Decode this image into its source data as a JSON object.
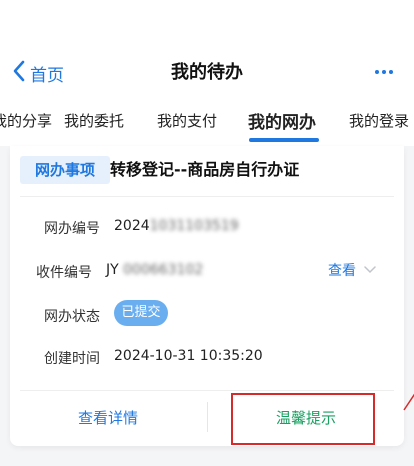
{
  "nav": {
    "back_label": "首页",
    "title": "我的待办"
  },
  "tabs": [
    {
      "label": "我的分享"
    },
    {
      "label": "我的委托"
    },
    {
      "label": "我的支付"
    },
    {
      "label": "我的网办",
      "active": true
    },
    {
      "label": "我的登录"
    }
  ],
  "card": {
    "badge": "网办事项",
    "title": "转移登记--商品房自行办证",
    "rows": {
      "online_no_label": "网办编号",
      "online_no_prefix": "2024",
      "online_no_blurred": "1031103519",
      "receipt_no_label": "收件编号",
      "receipt_no_prefix": "JY",
      "receipt_no_blurred": "000663102",
      "view_label": "查看",
      "status_label": "网办状态",
      "status_value": "已提交",
      "created_label": "创建时间",
      "created_value": "2024-10-31 10:35:20"
    },
    "actions": {
      "details": "查看详情",
      "tips": "温馨提示"
    }
  },
  "colors": {
    "accent": "#1f78e0",
    "tips_green": "#1aa062",
    "status_pill": "#6aaef0",
    "highlight_red": "#d62b2b"
  },
  "icons": [
    "chevron-left-icon",
    "more-icon",
    "chevron-down-icon"
  ]
}
